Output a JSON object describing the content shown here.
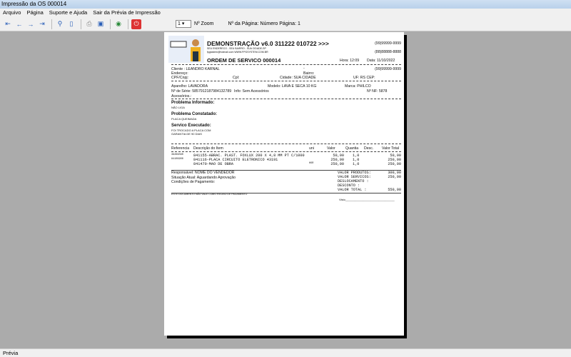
{
  "window": {
    "title": "Impressão da OS 000014"
  },
  "menu": [
    "Arquivo",
    "Página",
    "Suporte e Ajuda",
    "Sair da Prévia de Impressão"
  ],
  "toolbar": {
    "zoom_value": "1",
    "zoom_label": "Nº Zoom",
    "page_label": "Nº da Página: Número Página: 1"
  },
  "status": "Prévia",
  "doc": {
    "company": "DEMONSTRAÇÃO v6.0 311222 010722 >>>",
    "address": "SEU ENDERECO - SEU BAIRRO - SUA CIDADE-SP",
    "contact": "fpgsistem@hotmail.com  WWW.FPGSYSTEM.COM.BR",
    "phone1": "(99)99999-9999",
    "phone2": "(88)88888-8888",
    "title": "ORDEM DE SERVICO 000014",
    "hora": "Hora: 12:09",
    "data": "Data: 11/10/2022",
    "cliente": "Cliente    : LEANDRO KARNAL",
    "dash": "-",
    "cli_phone": "(99)99999-9999",
    "endereco": "Endereço:",
    "bairro": "Bairro:",
    "cpf": "CPF/Cnpj:",
    "cpl": "Cpl:",
    "cidade": "Cidade: SUA CIDADE",
    "uf": "UF: RS  CEP:",
    "aparelho": "Aparelho: LAVADORA",
    "modelo": "Modelo: LAVA E SECA 10 KG",
    "marca": "Marca: PHILCO",
    "serie": "Nº de Série: 5857912187984132789",
    "info": "Info: Sem Acessórios",
    "nf": "Nº NF: 5878",
    "acessorios": "Acessórios.:",
    "prob_inf_label": "Problema Informado:",
    "prob_inf": "NÃO LIGA",
    "prob_con_label": "Problema Constatado:",
    "prob_con": "PLACA QUEIMADA",
    "serv_label": "Servico Executado:",
    "serv1": "FOI TROCADO A PLACA COM",
    "serv2": "GARANTIA DE 90 DIAS",
    "headers": [
      "Referencia",
      "Descrição do Item",
      "uni",
      "Valor",
      "Quantia",
      "Desc.",
      "Valor Total"
    ],
    "items": [
      {
        "ref": "39269090",
        "desc": "841155-ABRAC. PLAST. FOXLUX 200 X 4,8 MM PT C/1000",
        "uni": "",
        "valor": "50,00",
        "qtd": "1,0",
        "desc2": "",
        "total": "50,00"
      },
      {
        "ref": "84109900",
        "desc": "841116-PLACA CIRCUITO ELETRONICO 43191",
        "uni": "",
        "valor": "250,00",
        "qtd": "1,0",
        "desc2": "",
        "total": "250,00"
      },
      {
        "ref": "",
        "desc": "841470-MAO DE OBRA",
        "uni": "HOR",
        "valor": "250,00",
        "qtd": "1,0",
        "desc2": "",
        "total": "250,00"
      }
    ],
    "responsavel": "Responsável: NOME DO VENDEDOR",
    "situacao": "Situação Atual: Aguardando Aprovação",
    "condicoes": "Condições de Pagamento:",
    "totals": [
      {
        "label": "VALOR PRODUTOS:",
        "value": "300,00"
      },
      {
        "label": "VALOR SERVICOS:",
        "value": "250,00"
      },
      {
        "label": "DESLOCAMENTO   :",
        "value": ""
      },
      {
        "label": "DESCONTO       :",
        "value": ""
      },
      {
        "label": "VALOR TOTAL    :",
        "value": "550,00"
      }
    ],
    "footer": "ESTE DOCUMENTO NÃO VALE COMO RECIBO DE PAGAMENTO",
    "visto": "Visto_______________________________"
  }
}
